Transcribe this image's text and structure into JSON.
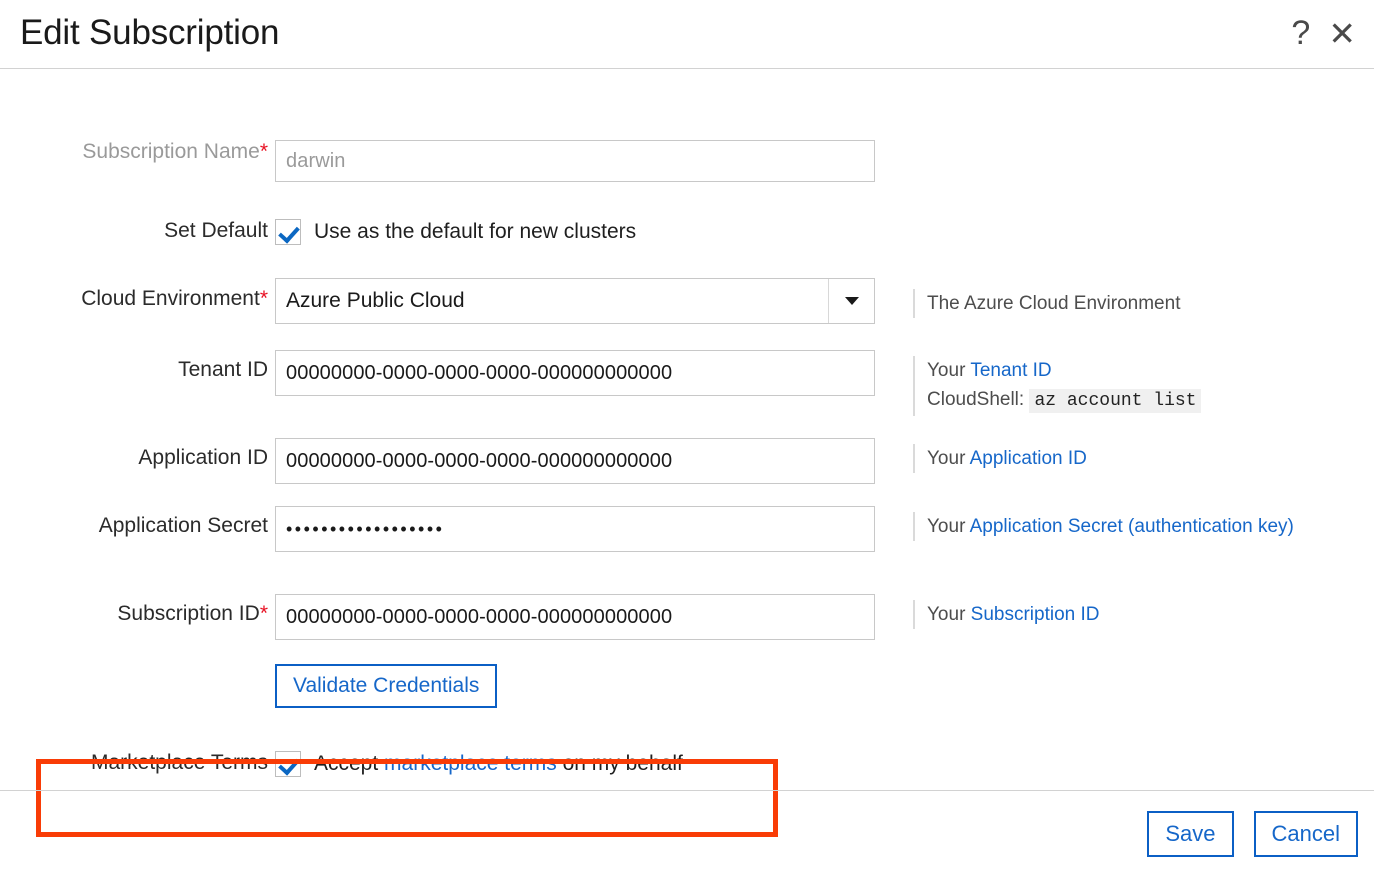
{
  "header": {
    "title": "Edit Subscription",
    "help_icon": "question-mark-icon",
    "help_glyph": "?",
    "close_icon": "close-icon",
    "close_glyph": "✕"
  },
  "form": {
    "subscription_name": {
      "label": "Subscription Name",
      "required_marker": "*",
      "value": "darwin"
    },
    "set_default": {
      "label": "Set Default",
      "checkbox_label": "Use as the default for new clusters",
      "checked": true
    },
    "cloud_environment": {
      "label": "Cloud Environment",
      "required_marker": "*",
      "value": "Azure Public Cloud",
      "hint": "The Azure Cloud Environment"
    },
    "tenant_id": {
      "label": "Tenant ID",
      "value": "00000000-0000-0000-0000-000000000000",
      "hint_prefix": "Your ",
      "hint_link": "Tenant ID",
      "hint_line2_prefix": "CloudShell: ",
      "hint_code": "az account list"
    },
    "application_id": {
      "label": "Application ID",
      "value": "00000000-0000-0000-0000-000000000000",
      "hint_prefix": "Your ",
      "hint_link": "Application ID"
    },
    "application_secret": {
      "label": "Application Secret",
      "value": "••••••••••••••••••",
      "hint_prefix": "Your ",
      "hint_link": "Application Secret (authentication key)"
    },
    "subscription_id": {
      "label": "Subscription ID",
      "required_marker": "*",
      "value": "00000000-0000-0000-0000-000000000000",
      "hint_prefix": "Your ",
      "hint_link": "Subscription ID"
    },
    "validate_button": "Validate Credentials",
    "marketplace_terms": {
      "label": "Marketplace Terms",
      "checked": true,
      "text_before": "Accept ",
      "link": "marketplace terms",
      "text_after": " on my behalf"
    }
  },
  "footer": {
    "save_label": "Save",
    "cancel_label": "Cancel"
  },
  "colors": {
    "link": "#1667c9",
    "required": "#e81123",
    "annotation": "#f93c06",
    "button_border": "#0b5fc5"
  }
}
